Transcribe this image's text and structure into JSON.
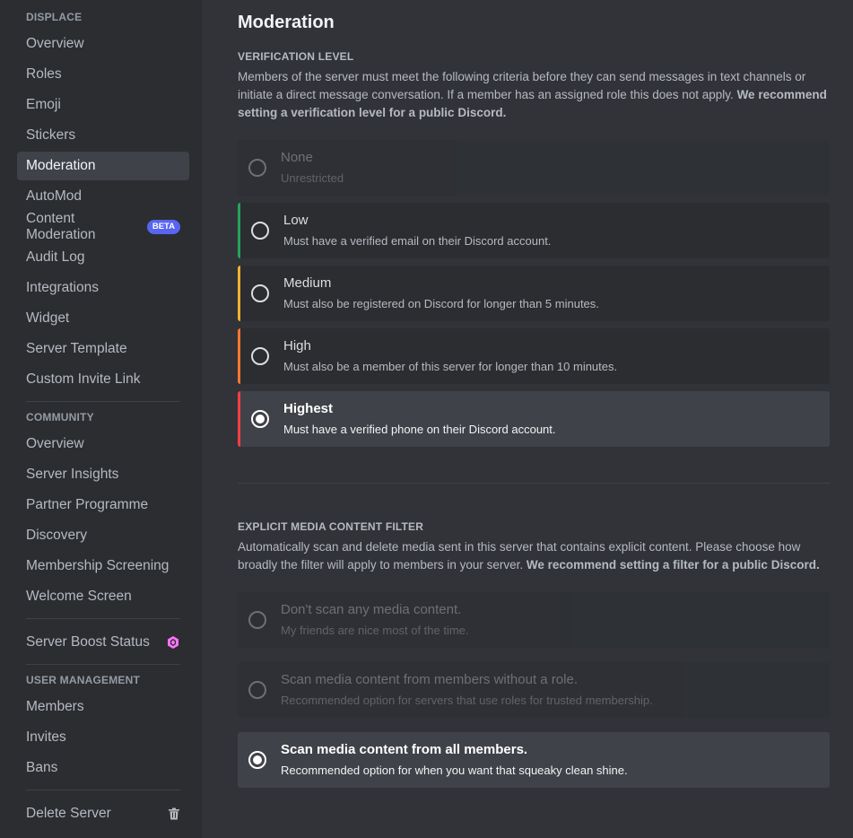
{
  "sidebar": {
    "server_section": "DISPLACE",
    "server_items": [
      {
        "label": "Overview"
      },
      {
        "label": "Roles"
      },
      {
        "label": "Emoji"
      },
      {
        "label": "Stickers"
      },
      {
        "label": "Moderation"
      },
      {
        "label": "AutoMod"
      },
      {
        "label": "Content Moderation",
        "badge": "BETA"
      },
      {
        "label": "Audit Log"
      },
      {
        "label": "Integrations"
      },
      {
        "label": "Widget"
      },
      {
        "label": "Server Template"
      },
      {
        "label": "Custom Invite Link"
      }
    ],
    "community_section": "COMMUNITY",
    "community_items": [
      {
        "label": "Overview"
      },
      {
        "label": "Server Insights"
      },
      {
        "label": "Partner Programme"
      },
      {
        "label": "Discovery"
      },
      {
        "label": "Membership Screening"
      },
      {
        "label": "Welcome Screen"
      }
    ],
    "boost_label": "Server Boost Status",
    "boost_icon": "boost-gem-icon",
    "user_section": "USER MANAGEMENT",
    "user_items": [
      {
        "label": "Members"
      },
      {
        "label": "Invites"
      },
      {
        "label": "Bans"
      }
    ],
    "delete_label": "Delete Server",
    "delete_icon": "trash-icon",
    "active_item": "Moderation"
  },
  "main": {
    "title": "Moderation",
    "verification": {
      "header": "VERIFICATION LEVEL",
      "desc_plain": "Members of the server must meet the following criteria before they can send messages in text channels or initiate a direct message conversation. If a member has an assigned role this does not apply. ",
      "desc_bold": "We recommend setting a verification level for a public Discord.",
      "options": [
        {
          "title": "None",
          "subtitle": "Unrestricted",
          "state": "disabled",
          "color": ""
        },
        {
          "title": "Low",
          "subtitle": "Must have a verified email on their Discord account.",
          "state": "unchecked",
          "color": "#23a55a"
        },
        {
          "title": "Medium",
          "subtitle": "Must also be registered on Discord for longer than 5 minutes.",
          "state": "unchecked",
          "color": "#f0b232"
        },
        {
          "title": "High",
          "subtitle": "Must also be a member of this server for longer than 10 minutes.",
          "state": "unchecked",
          "color": "#f57731"
        },
        {
          "title": "Highest",
          "subtitle": "Must have a verified phone on their Discord account.",
          "state": "checked",
          "color": "#f23f43"
        }
      ]
    },
    "filter": {
      "header": "EXPLICIT MEDIA CONTENT FILTER",
      "desc_plain": "Automatically scan and delete media sent in this server that contains explicit content. Please choose how broadly the filter will apply to members in your server. ",
      "desc_bold": "We recommend setting a filter for a public Discord.",
      "options": [
        {
          "title": "Don't scan any media content.",
          "subtitle": "My friends are nice most of the time.",
          "state": "disabled"
        },
        {
          "title": "Scan media content from members without a role.",
          "subtitle": "Recommended option for servers that use roles for trusted membership.",
          "state": "disabled"
        },
        {
          "title": "Scan media content from all members.",
          "subtitle": "Recommended option for when you want that squeaky clean shine.",
          "state": "checked"
        }
      ]
    }
  }
}
